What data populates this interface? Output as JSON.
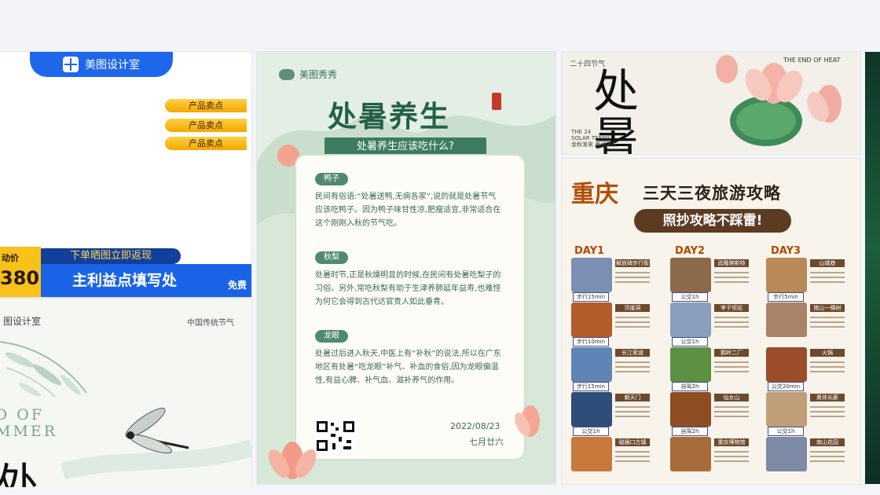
{
  "cards": {
    "c1": {
      "brand": "美图设计室",
      "pills": [
        "产品卖点",
        "产品卖点",
        "产品卖点"
      ],
      "price_label": "动价",
      "price_value": "380",
      "fanxian": "下单晒图立即返现",
      "band_text": "主利益点填写处",
      "free": "免费"
    },
    "c2": {
      "brand": "图设计室",
      "tag": "中国传统节气",
      "end_text_1": "D OF",
      "end_text_2": "MMER",
      "big_char": "处"
    },
    "c3": {
      "brand": "美图秀秀",
      "title": "处暑养生",
      "subtitle": "处暑养生应该吃什么?",
      "sections": [
        {
          "label": "鸭子",
          "text": "民间有俗语:“处暑送鸭,无病各家”,说的就是处暑节气应该吃鸭子。因为鸭子味甘性凉,肥瘦适宜,非常适合在这个刚刚入秋的节气吃。"
        },
        {
          "label": "秋梨",
          "text": "处暑时节,正是秋燥明显的时候,在民间有处暑吃梨子的习俗。另外,常吃秋梨有助于生津养肺延年益寿,也难怪为何它会得到古代达官贵人如此垂青。"
        },
        {
          "label": "龙眼",
          "text": "处暑过后进入秋天,中医上有“补秋”的说法,所以在广东地区有处暑“吃龙眼”补气、补血的食俗,因为龙眼偏温性,有益心脾、补气血、滋补养气的作用。"
        }
      ],
      "date": "2022/08/23",
      "lunar": "七月廿六"
    },
    "c4": {
      "small": "二十四节气",
      "end": "THE END OF HEAT",
      "big": "处\n暑",
      "terms": "THE 24\nSOLAR TERMS\n金秋渐来 暑润渐去"
    },
    "c5": {
      "city": "重庆",
      "title": "三天三夜旅游攻略",
      "bar": "照抄攻略不踩雷!",
      "days": [
        "DAY1",
        "DAY2",
        "DAY3"
      ],
      "tags": [
        [
          "步行15min",
          "步行10min",
          "步行15min",
          "公交1h",
          ""
        ],
        [
          "公交1h",
          "公交1h",
          "自驾2h",
          "自驾2h",
          ""
        ],
        [
          "步行5min",
          "",
          "公交20min",
          "公交1h",
          ""
        ]
      ],
      "chips": [
        [
          "解放碑步行街",
          "洪崖洞",
          "长江索道",
          "朝天门",
          "磁器口古镇"
        ],
        [
          "武隆喀斯特",
          "李子坝站",
          "鹅岭二厂",
          "仙女山",
          "重庆博物馆"
        ],
        [
          "山城巷",
          "南山一棵树",
          "火锅",
          "奥体长廊",
          "南山花园"
        ]
      ]
    }
  },
  "colors": {
    "brand_blue": "#1f67ea",
    "gold": "#f8c21a",
    "green_title": "#236247",
    "cq_orange": "#b24d09",
    "cq_brown": "#5c3b22"
  }
}
